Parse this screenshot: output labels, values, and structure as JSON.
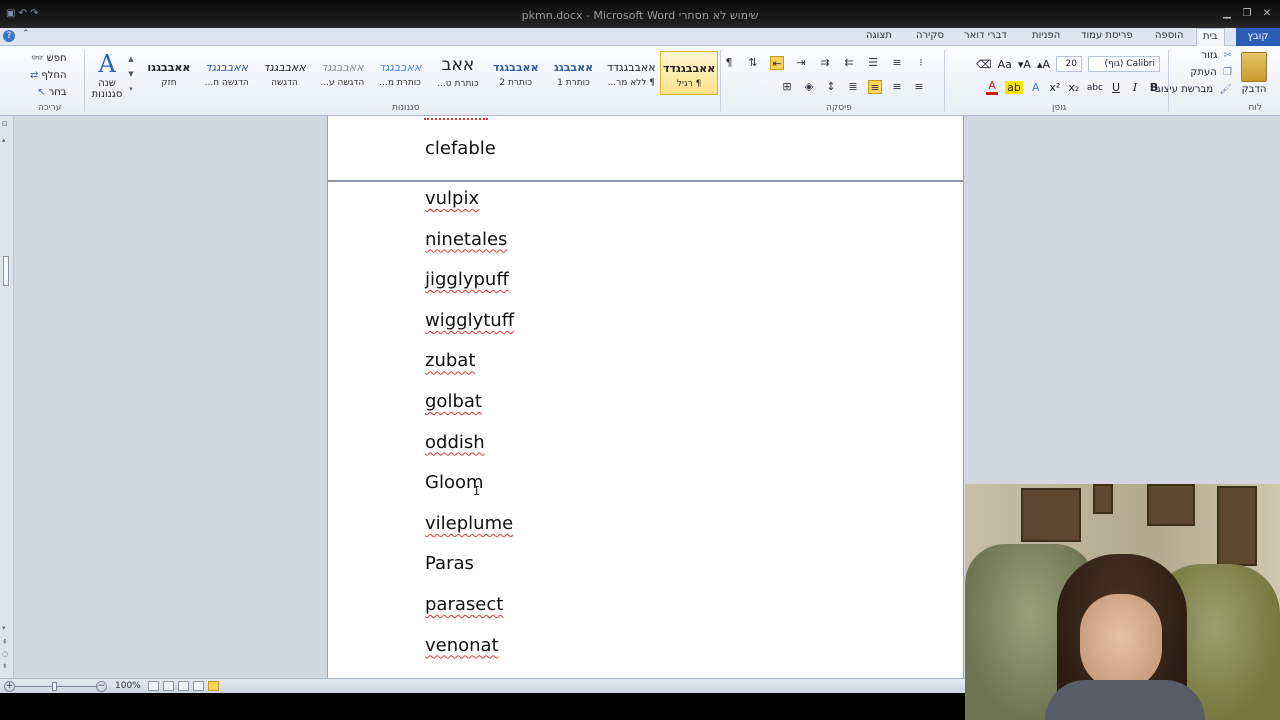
{
  "window": {
    "title": "pkmn.docx - Microsoft Word שימוש לא מסחרי"
  },
  "tabs": {
    "file": "קובץ",
    "items": [
      "בית",
      "הוספה",
      "פריסת עמוד",
      "הפניות",
      "דברי דואר",
      "סקירה",
      "תצוגה"
    ],
    "active": "בית"
  },
  "clipboard": {
    "paste": "הדבק",
    "cut": "גזור",
    "copy": "העתק",
    "format_painter": "מברשת עיצוב",
    "label": "לוח"
  },
  "font": {
    "name": "Calibri (גוף)",
    "size": "20",
    "label": "גופן"
  },
  "paragraph": {
    "label": "פיסקה"
  },
  "styles": {
    "items": [
      {
        "sample": "אאבבגגדד",
        "name": "¶ רגיל"
      },
      {
        "sample": "אאבבגגדד",
        "name": "¶ ללא מר..."
      },
      {
        "sample": "אאבבגג",
        "name": "כותרת 1"
      },
      {
        "sample": "אאבבגגד",
        "name": "כותרת 2"
      },
      {
        "sample": "אאב",
        "name": "כותרת ט..."
      },
      {
        "sample": "אאבבגגד",
        "name": "כותרת מ..."
      },
      {
        "sample": "אאבבגגד",
        "name": "הדגשה ע..."
      },
      {
        "sample": "אאבבגגד",
        "name": "הדגשה"
      },
      {
        "sample": "אאבבגגד",
        "name": "הדגשה ח..."
      },
      {
        "sample": "אאבבגגו",
        "name": "חזק"
      }
    ],
    "label": "סגנונות",
    "change_styles": "שנה סגנונות"
  },
  "editing": {
    "find": "חפש",
    "replace": "החלף",
    "select": "בחר",
    "label": "עריכה"
  },
  "document": {
    "top_word": "clefable",
    "words": [
      {
        "text": "vulpix",
        "misspelled": true
      },
      {
        "text": "ninetales",
        "misspelled": true
      },
      {
        "text": "jigglypuff",
        "misspelled": true
      },
      {
        "text": "wigglytuff",
        "misspelled": true
      },
      {
        "text": "zubat",
        "misspelled": true
      },
      {
        "text": "golbat",
        "misspelled": true
      },
      {
        "text": "oddish",
        "misspelled": true
      },
      {
        "text": "Gloom",
        "misspelled": false
      },
      {
        "text": "vileplume",
        "misspelled": true
      },
      {
        "text": "Paras",
        "misspelled": false
      },
      {
        "text": "parasect",
        "misspelled": true
      },
      {
        "text": "venonat",
        "misspelled": true
      }
    ]
  },
  "statusbar": {
    "zoom": "100%"
  },
  "colors": {
    "accent": "#2a5db5",
    "spellcheck": "#e23b3b"
  }
}
